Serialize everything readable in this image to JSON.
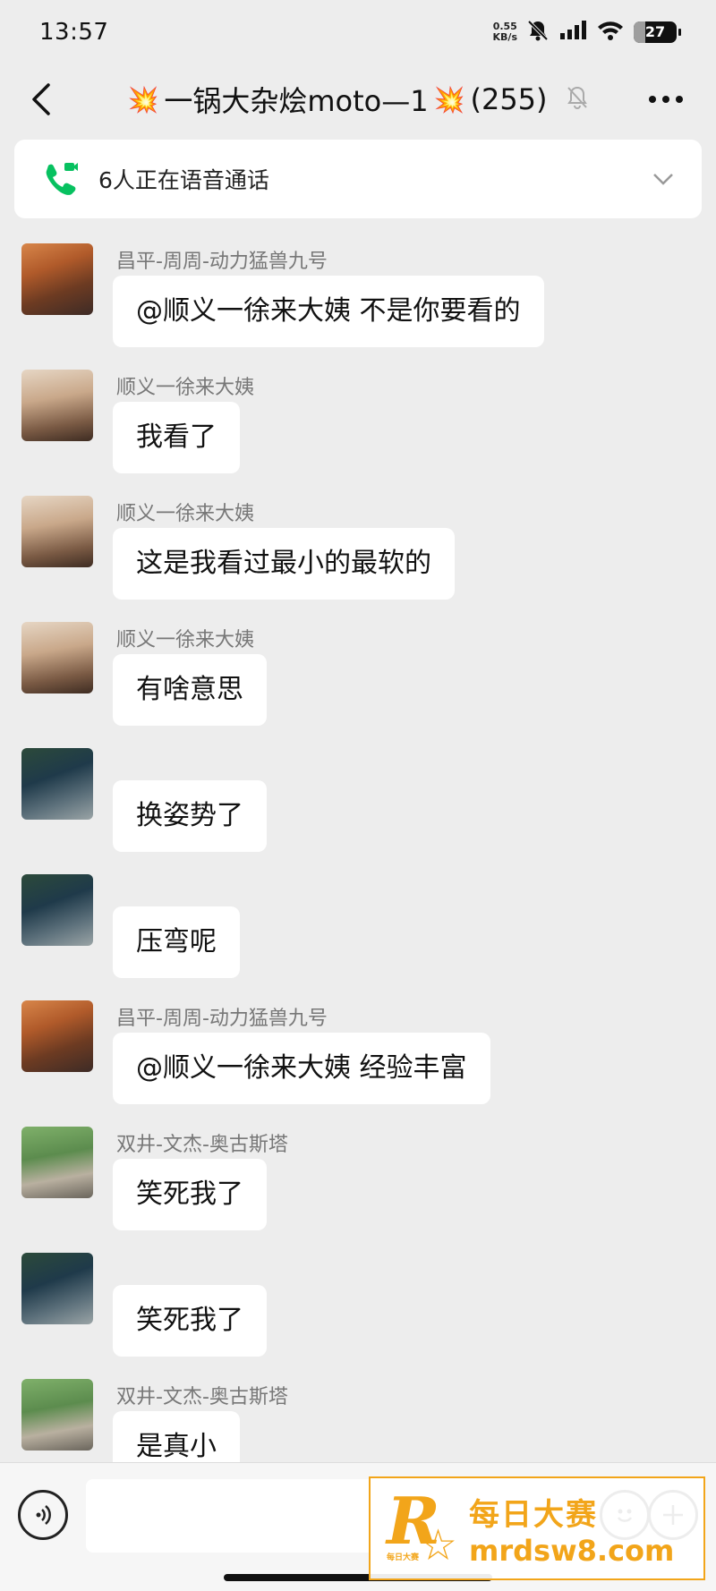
{
  "status_bar": {
    "time": "13:57",
    "net_speed_value": "0.55",
    "net_speed_unit": "KB/s",
    "battery": "27",
    "icons": [
      "mute-bell-icon",
      "signal-icon",
      "wifi-icon",
      "battery-icon"
    ]
  },
  "header": {
    "emoji_left": "💥",
    "title": "一锅大杂烩moto—1",
    "emoji_right": "💥",
    "member_count": "(255)",
    "icons": [
      "back-icon",
      "mute-bell-icon",
      "more-icon"
    ]
  },
  "voice_call": {
    "text": "6人正在语音通话",
    "icons": [
      "phone-video-icon",
      "chevron-down-icon"
    ]
  },
  "messages": [
    {
      "sender": "昌平-周周-动力猛兽九号",
      "text": "@顺义一徐来大姨  不是你要看的",
      "avatar": "moto-sunset"
    },
    {
      "sender": "顺义一徐来大姨",
      "text": "我看了",
      "avatar": "girl"
    },
    {
      "sender": "顺义一徐来大姨",
      "text": "这是我看过最小的最软的",
      "avatar": "girl"
    },
    {
      "sender": "顺义一徐来大姨",
      "text": "有啥意思",
      "avatar": "girl"
    },
    {
      "sender": "",
      "text": "换姿势了",
      "avatar": "moto-forest"
    },
    {
      "sender": "",
      "text": "压弯呢",
      "avatar": "moto-forest"
    },
    {
      "sender": "昌平-周周-动力猛兽九号",
      "text": "@顺义一徐来大姨  经验丰富",
      "avatar": "moto-sunset"
    },
    {
      "sender": "双井-文杰-奥古斯塔",
      "text": "笑死我了",
      "avatar": "boy"
    },
    {
      "sender": "",
      "text": "笑死我了",
      "avatar": "moto-forest"
    },
    {
      "sender": "双井-文杰-奥古斯塔",
      "text": "是真小",
      "avatar": "boy"
    }
  ],
  "input_bar": {
    "placeholder": "",
    "icons": [
      "voice-input-icon",
      "emoji-icon",
      "plus-icon"
    ]
  },
  "watermark": {
    "logo_letter": "R",
    "logo_small": "每日大赛",
    "name": "每日大赛",
    "url": "mrdsw8.com"
  },
  "colors": {
    "background": "#ededed",
    "bubble": "#ffffff",
    "call_green": "#07c160",
    "watermark_orange": "#f2a51a"
  }
}
